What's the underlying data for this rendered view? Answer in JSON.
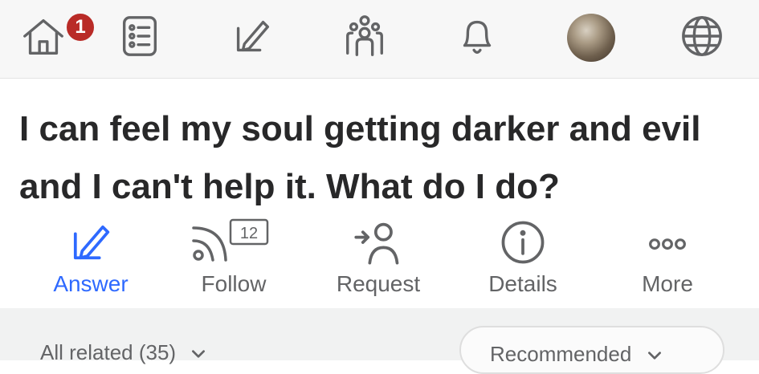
{
  "nav": {
    "items": [
      {
        "name": "home-icon",
        "badge": "1"
      },
      {
        "name": "following-feed-icon"
      },
      {
        "name": "write-icon"
      },
      {
        "name": "spaces-icon"
      },
      {
        "name": "notifications-bell-icon"
      },
      {
        "name": "profile-avatar"
      },
      {
        "name": "language-globe-icon"
      }
    ]
  },
  "question": {
    "title": "I can feel my soul getting darker and evil and I can't help it. What do I do?"
  },
  "actions": {
    "answer": "Answer",
    "follow": "Follow",
    "follow_count": "12",
    "request": "Request",
    "details": "Details",
    "more": "More"
  },
  "colors": {
    "accent": "#2e69ff",
    "badge": "#b92b27",
    "text": "#282829",
    "muted": "#636466"
  },
  "related": {
    "label": "All related (35)",
    "sort": "Recommended"
  }
}
